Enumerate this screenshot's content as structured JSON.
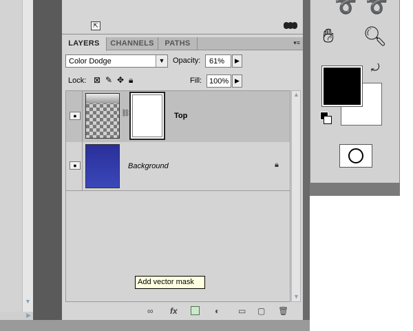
{
  "layers_panel": {
    "tabs": [
      "LAYERS",
      "CHANNELS",
      "PATHS"
    ],
    "blend_mode": "Color Dodge",
    "opacity_label": "Opacity:",
    "opacity_value": "61%",
    "lock_label": "Lock:",
    "fill_label": "Fill:",
    "fill_value": "100%",
    "layers": [
      {
        "name": "Top",
        "visible": true,
        "has_mask": true
      },
      {
        "name": "Background",
        "visible": true,
        "locked": true
      }
    ],
    "bottom_icons": [
      "link-layers-icon",
      "fx-icon",
      "add-vector-mask-icon",
      "adjustment-layer-icon",
      "new-group-icon",
      "new-layer-icon",
      "trash-icon"
    ],
    "fx_label": "fx",
    "tooltip": "Add vector mask"
  },
  "tools": {
    "icons": [
      "lasso-icon",
      "polygonal-lasso-icon",
      "hand-icon",
      "zoom-icon",
      "swap-colors-icon",
      "default-colors-icon",
      "quick-mask-icon"
    ],
    "foreground_color": "#000000",
    "background_color": "#ffffff"
  },
  "colors": {
    "panel_bg": "#d6d6d6",
    "selected_row": "#bfbfbf",
    "background_layer_fill": "#2f3aa8",
    "tooltip_bg": "#ffffe1"
  }
}
